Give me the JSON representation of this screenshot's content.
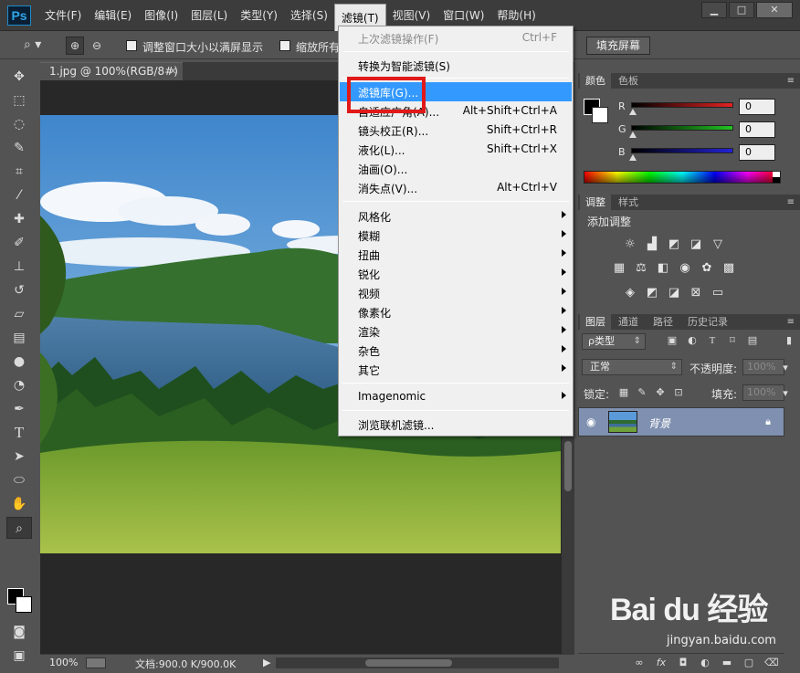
{
  "app": {
    "logo": "Ps",
    "menu": [
      "文件(F)",
      "编辑(E)",
      "图像(I)",
      "图层(L)",
      "类型(Y)",
      "选择(S)",
      "滤镜(T)",
      "视图(V)",
      "窗口(W)",
      "帮助(H)"
    ],
    "active_menu": "滤镜(T)"
  },
  "window_controls": {
    "minimize": "▁",
    "maximize": "□",
    "close": "✕"
  },
  "options_bar": {
    "resize_windows_label": "调整窗口大小以满屏显示",
    "zoom_all_label": "缩放所有",
    "fill_screen_button": "填充屏幕"
  },
  "document": {
    "tab_title": "1.jpg @ 100%(RGB/8#)",
    "tab_close": "×"
  },
  "status": {
    "zoom": "100%",
    "doc_size": "文档:900.0 K/900.0K",
    "arrow": "▶"
  },
  "filter_menu": {
    "items": [
      {
        "label": "上次滤镜操作(F)",
        "shortcut": "Ctrl+F",
        "disabled": true
      },
      {
        "label": "转换为智能滤镜(S)",
        "shortcut": ""
      },
      {
        "label": "滤镜库(G)...",
        "shortcut": "",
        "highlighted": true
      },
      {
        "label": "自适应广角(A)...",
        "shortcut": "Alt+Shift+Ctrl+A"
      },
      {
        "label": "镜头校正(R)...",
        "shortcut": "Shift+Ctrl+R"
      },
      {
        "label": "液化(L)...",
        "shortcut": "Shift+Ctrl+X"
      },
      {
        "label": "油画(O)...",
        "shortcut": ""
      },
      {
        "label": "消失点(V)...",
        "shortcut": "Alt+Ctrl+V"
      },
      {
        "label": "风格化",
        "submenu": true
      },
      {
        "label": "模糊",
        "submenu": true
      },
      {
        "label": "扭曲",
        "submenu": true
      },
      {
        "label": "锐化",
        "submenu": true
      },
      {
        "label": "视频",
        "submenu": true
      },
      {
        "label": "像素化",
        "submenu": true
      },
      {
        "label": "渲染",
        "submenu": true
      },
      {
        "label": "杂色",
        "submenu": true
      },
      {
        "label": "其它",
        "submenu": true
      },
      {
        "label": "Imagenomic",
        "submenu": true
      },
      {
        "label": "浏览联机滤镜..."
      }
    ]
  },
  "color_panel": {
    "tabs": [
      "颜色",
      "色板"
    ],
    "r_label": "R",
    "g_label": "G",
    "b_label": "B",
    "r_value": "0",
    "g_value": "0",
    "b_value": "0",
    "colors": {
      "r": "#e32222",
      "g": "#22c322",
      "b": "#2222d6"
    }
  },
  "adjust_panel": {
    "tabs": [
      "调整",
      "样式"
    ],
    "title": "添加调整"
  },
  "layers_panel": {
    "tabs": [
      "图层",
      "通道",
      "路径",
      "历史记录"
    ],
    "filter_type": "ρ类型",
    "blend_mode": "正常",
    "opacity_label": "不透明度:",
    "opacity_value": "100%",
    "lock_label": "锁定:",
    "fill_label": "填充:",
    "fill_value": "100%",
    "layer_name": "背景"
  },
  "watermark": {
    "logo": "Bai du 经验",
    "url": "jingyan.baidu.com"
  }
}
